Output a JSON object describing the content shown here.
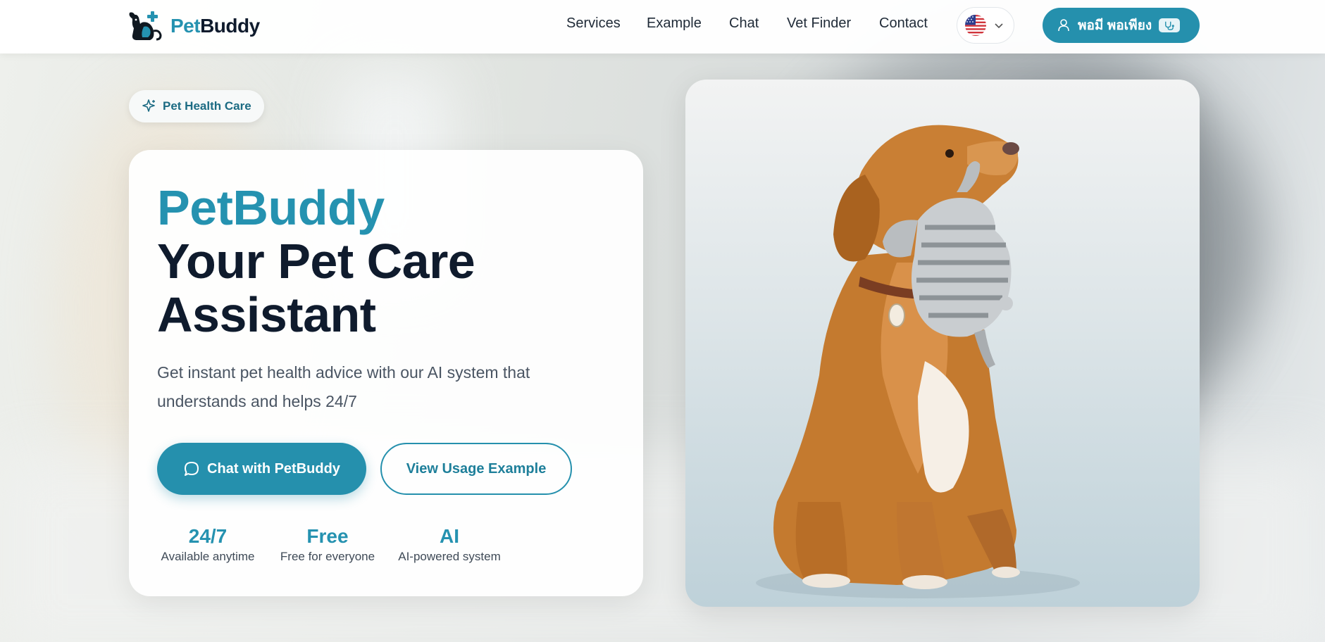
{
  "brand": {
    "name_part1": "Pet",
    "name_part2": "Buddy"
  },
  "nav": [
    {
      "label": "Services"
    },
    {
      "label": "Example"
    },
    {
      "label": "Chat"
    },
    {
      "label": "Vet Finder"
    },
    {
      "label": "Contact"
    }
  ],
  "language": {
    "selected": "English (US)",
    "flag_icon": "us-flag-icon"
  },
  "user": {
    "name": "พอมี พอเพียง",
    "role_icon": "stethoscope-icon"
  },
  "hero": {
    "badge": "Pet Health Care",
    "title_brand": "PetBuddy",
    "title_line1": "Your Pet Care",
    "title_line2": "Assistant",
    "description": "Get instant pet health advice with our AI system that understands and helps 24/7",
    "primary_button": "Chat with PetBuddy",
    "secondary_button": "View Usage Example",
    "stats": [
      {
        "value": "24/7",
        "label": "Available anytime"
      },
      {
        "value": "Free",
        "label": "Free for everyone"
      },
      {
        "value": "AI",
        "label": "AI-powered system"
      }
    ]
  },
  "colors": {
    "accent": "#2590ad",
    "dark": "#0f1b2d",
    "text": "#4a5563"
  }
}
